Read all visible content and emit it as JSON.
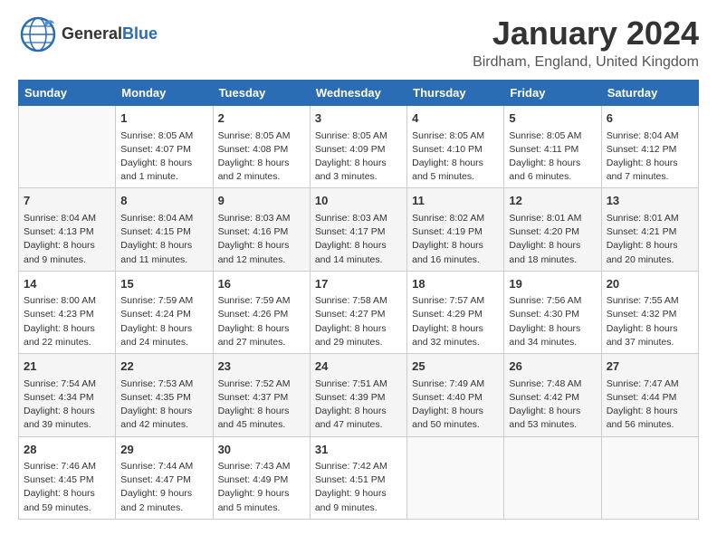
{
  "header": {
    "logo_general": "General",
    "logo_blue": "Blue",
    "month_title": "January 2024",
    "location": "Birdham, England, United Kingdom"
  },
  "days_of_week": [
    "Sunday",
    "Monday",
    "Tuesday",
    "Wednesday",
    "Thursday",
    "Friday",
    "Saturday"
  ],
  "weeks": [
    [
      {
        "day": "",
        "sunrise": "",
        "sunset": "",
        "daylight": ""
      },
      {
        "day": "1",
        "sunrise": "Sunrise: 8:05 AM",
        "sunset": "Sunset: 4:07 PM",
        "daylight": "Daylight: 8 hours and 1 minute."
      },
      {
        "day": "2",
        "sunrise": "Sunrise: 8:05 AM",
        "sunset": "Sunset: 4:08 PM",
        "daylight": "Daylight: 8 hours and 2 minutes."
      },
      {
        "day": "3",
        "sunrise": "Sunrise: 8:05 AM",
        "sunset": "Sunset: 4:09 PM",
        "daylight": "Daylight: 8 hours and 3 minutes."
      },
      {
        "day": "4",
        "sunrise": "Sunrise: 8:05 AM",
        "sunset": "Sunset: 4:10 PM",
        "daylight": "Daylight: 8 hours and 5 minutes."
      },
      {
        "day": "5",
        "sunrise": "Sunrise: 8:05 AM",
        "sunset": "Sunset: 4:11 PM",
        "daylight": "Daylight: 8 hours and 6 minutes."
      },
      {
        "day": "6",
        "sunrise": "Sunrise: 8:04 AM",
        "sunset": "Sunset: 4:12 PM",
        "daylight": "Daylight: 8 hours and 7 minutes."
      }
    ],
    [
      {
        "day": "7",
        "sunrise": "Sunrise: 8:04 AM",
        "sunset": "Sunset: 4:13 PM",
        "daylight": "Daylight: 8 hours and 9 minutes."
      },
      {
        "day": "8",
        "sunrise": "Sunrise: 8:04 AM",
        "sunset": "Sunset: 4:15 PM",
        "daylight": "Daylight: 8 hours and 11 minutes."
      },
      {
        "day": "9",
        "sunrise": "Sunrise: 8:03 AM",
        "sunset": "Sunset: 4:16 PM",
        "daylight": "Daylight: 8 hours and 12 minutes."
      },
      {
        "day": "10",
        "sunrise": "Sunrise: 8:03 AM",
        "sunset": "Sunset: 4:17 PM",
        "daylight": "Daylight: 8 hours and 14 minutes."
      },
      {
        "day": "11",
        "sunrise": "Sunrise: 8:02 AM",
        "sunset": "Sunset: 4:19 PM",
        "daylight": "Daylight: 8 hours and 16 minutes."
      },
      {
        "day": "12",
        "sunrise": "Sunrise: 8:01 AM",
        "sunset": "Sunset: 4:20 PM",
        "daylight": "Daylight: 8 hours and 18 minutes."
      },
      {
        "day": "13",
        "sunrise": "Sunrise: 8:01 AM",
        "sunset": "Sunset: 4:21 PM",
        "daylight": "Daylight: 8 hours and 20 minutes."
      }
    ],
    [
      {
        "day": "14",
        "sunrise": "Sunrise: 8:00 AM",
        "sunset": "Sunset: 4:23 PM",
        "daylight": "Daylight: 8 hours and 22 minutes."
      },
      {
        "day": "15",
        "sunrise": "Sunrise: 7:59 AM",
        "sunset": "Sunset: 4:24 PM",
        "daylight": "Daylight: 8 hours and 24 minutes."
      },
      {
        "day": "16",
        "sunrise": "Sunrise: 7:59 AM",
        "sunset": "Sunset: 4:26 PM",
        "daylight": "Daylight: 8 hours and 27 minutes."
      },
      {
        "day": "17",
        "sunrise": "Sunrise: 7:58 AM",
        "sunset": "Sunset: 4:27 PM",
        "daylight": "Daylight: 8 hours and 29 minutes."
      },
      {
        "day": "18",
        "sunrise": "Sunrise: 7:57 AM",
        "sunset": "Sunset: 4:29 PM",
        "daylight": "Daylight: 8 hours and 32 minutes."
      },
      {
        "day": "19",
        "sunrise": "Sunrise: 7:56 AM",
        "sunset": "Sunset: 4:30 PM",
        "daylight": "Daylight: 8 hours and 34 minutes."
      },
      {
        "day": "20",
        "sunrise": "Sunrise: 7:55 AM",
        "sunset": "Sunset: 4:32 PM",
        "daylight": "Daylight: 8 hours and 37 minutes."
      }
    ],
    [
      {
        "day": "21",
        "sunrise": "Sunrise: 7:54 AM",
        "sunset": "Sunset: 4:34 PM",
        "daylight": "Daylight: 8 hours and 39 minutes."
      },
      {
        "day": "22",
        "sunrise": "Sunrise: 7:53 AM",
        "sunset": "Sunset: 4:35 PM",
        "daylight": "Daylight: 8 hours and 42 minutes."
      },
      {
        "day": "23",
        "sunrise": "Sunrise: 7:52 AM",
        "sunset": "Sunset: 4:37 PM",
        "daylight": "Daylight: 8 hours and 45 minutes."
      },
      {
        "day": "24",
        "sunrise": "Sunrise: 7:51 AM",
        "sunset": "Sunset: 4:39 PM",
        "daylight": "Daylight: 8 hours and 47 minutes."
      },
      {
        "day": "25",
        "sunrise": "Sunrise: 7:49 AM",
        "sunset": "Sunset: 4:40 PM",
        "daylight": "Daylight: 8 hours and 50 minutes."
      },
      {
        "day": "26",
        "sunrise": "Sunrise: 7:48 AM",
        "sunset": "Sunset: 4:42 PM",
        "daylight": "Daylight: 8 hours and 53 minutes."
      },
      {
        "day": "27",
        "sunrise": "Sunrise: 7:47 AM",
        "sunset": "Sunset: 4:44 PM",
        "daylight": "Daylight: 8 hours and 56 minutes."
      }
    ],
    [
      {
        "day": "28",
        "sunrise": "Sunrise: 7:46 AM",
        "sunset": "Sunset: 4:45 PM",
        "daylight": "Daylight: 8 hours and 59 minutes."
      },
      {
        "day": "29",
        "sunrise": "Sunrise: 7:44 AM",
        "sunset": "Sunset: 4:47 PM",
        "daylight": "Daylight: 9 hours and 2 minutes."
      },
      {
        "day": "30",
        "sunrise": "Sunrise: 7:43 AM",
        "sunset": "Sunset: 4:49 PM",
        "daylight": "Daylight: 9 hours and 5 minutes."
      },
      {
        "day": "31",
        "sunrise": "Sunrise: 7:42 AM",
        "sunset": "Sunset: 4:51 PM",
        "daylight": "Daylight: 9 hours and 9 minutes."
      },
      {
        "day": "",
        "sunrise": "",
        "sunset": "",
        "daylight": ""
      },
      {
        "day": "",
        "sunrise": "",
        "sunset": "",
        "daylight": ""
      },
      {
        "day": "",
        "sunrise": "",
        "sunset": "",
        "daylight": ""
      }
    ]
  ]
}
